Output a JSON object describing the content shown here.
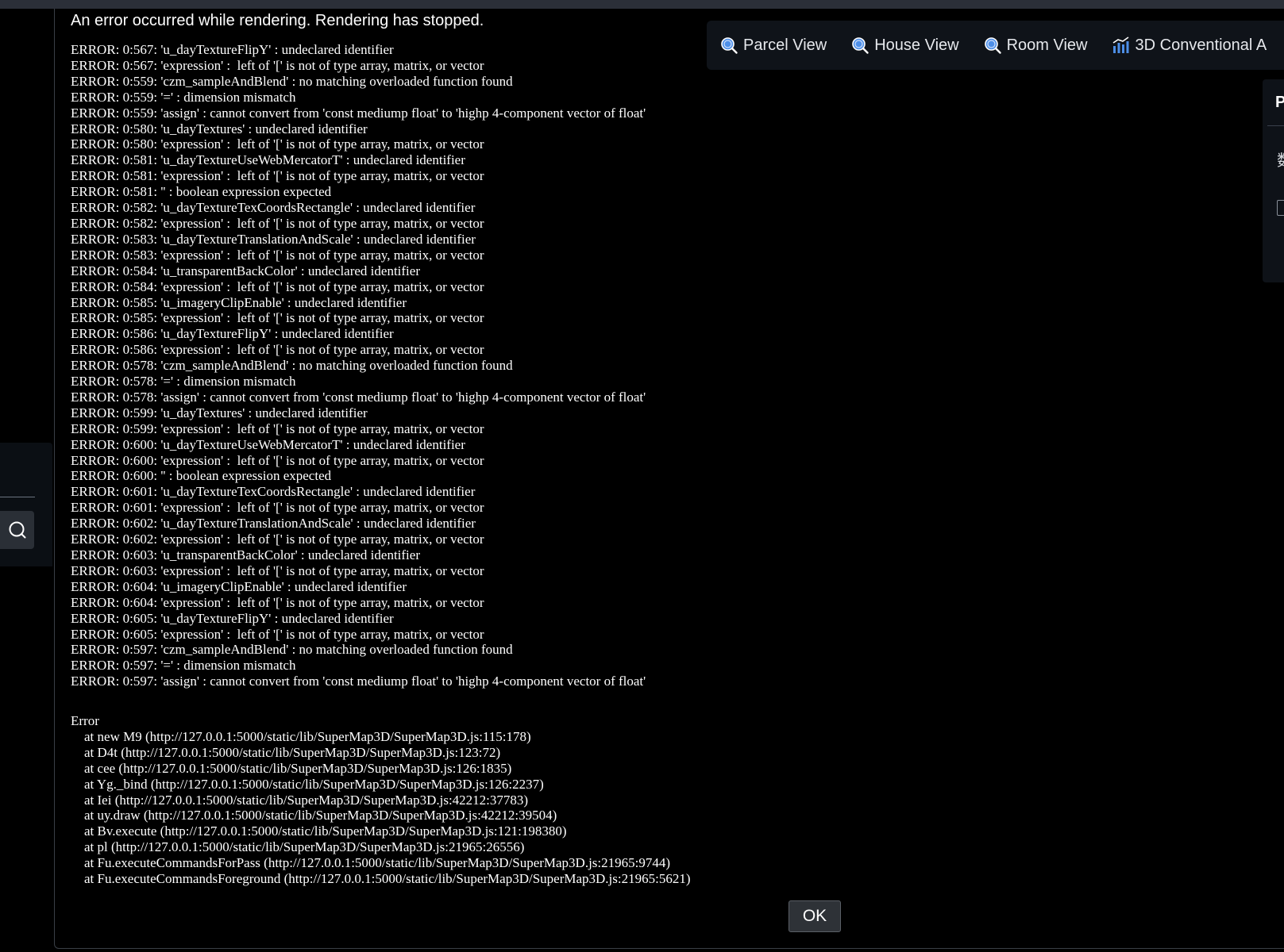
{
  "toolbar": {
    "items": [
      {
        "label": "Parcel View",
        "icon": "magnifier-icon"
      },
      {
        "label": "House View",
        "icon": "magnifier-icon"
      },
      {
        "label": "Room View",
        "icon": "magnifier-icon"
      },
      {
        "label": "3D Conventional A",
        "icon": "bar-chart-icon"
      }
    ],
    "accent_color": "#4d8fe8"
  },
  "right_panel": {
    "title": "P",
    "char": "数"
  },
  "dialog": {
    "title": "An error occurred while rendering. Rendering has stopped.",
    "log_lines": [
      "ERROR: 0:567: 'u_dayTextureFlipY' : undeclared identifier",
      "ERROR: 0:567: 'expression' :  left of '[' is not of type array, matrix, or vector",
      "ERROR: 0:559: 'czm_sampleAndBlend' : no matching overloaded function found",
      "ERROR: 0:559: '=' : dimension mismatch",
      "ERROR: 0:559: 'assign' : cannot convert from 'const mediump float' to 'highp 4-component vector of float'",
      "ERROR: 0:580: 'u_dayTextures' : undeclared identifier",
      "ERROR: 0:580: 'expression' :  left of '[' is not of type array, matrix, or vector",
      "ERROR: 0:581: 'u_dayTextureUseWebMercatorT' : undeclared identifier",
      "ERROR: 0:581: 'expression' :  left of '[' is not of type array, matrix, or vector",
      "ERROR: 0:581: '' : boolean expression expected",
      "ERROR: 0:582: 'u_dayTextureTexCoordsRectangle' : undeclared identifier",
      "ERROR: 0:582: 'expression' :  left of '[' is not of type array, matrix, or vector",
      "ERROR: 0:583: 'u_dayTextureTranslationAndScale' : undeclared identifier",
      "ERROR: 0:583: 'expression' :  left of '[' is not of type array, matrix, or vector",
      "ERROR: 0:584: 'u_transparentBackColor' : undeclared identifier",
      "ERROR: 0:584: 'expression' :  left of '[' is not of type array, matrix, or vector",
      "ERROR: 0:585: 'u_imageryClipEnable' : undeclared identifier",
      "ERROR: 0:585: 'expression' :  left of '[' is not of type array, matrix, or vector",
      "ERROR: 0:586: 'u_dayTextureFlipY' : undeclared identifier",
      "ERROR: 0:586: 'expression' :  left of '[' is not of type array, matrix, or vector",
      "ERROR: 0:578: 'czm_sampleAndBlend' : no matching overloaded function found",
      "ERROR: 0:578: '=' : dimension mismatch",
      "ERROR: 0:578: 'assign' : cannot convert from 'const mediump float' to 'highp 4-component vector of float'",
      "ERROR: 0:599: 'u_dayTextures' : undeclared identifier",
      "ERROR: 0:599: 'expression' :  left of '[' is not of type array, matrix, or vector",
      "ERROR: 0:600: 'u_dayTextureUseWebMercatorT' : undeclared identifier",
      "ERROR: 0:600: 'expression' :  left of '[' is not of type array, matrix, or vector",
      "ERROR: 0:600: '' : boolean expression expected",
      "ERROR: 0:601: 'u_dayTextureTexCoordsRectangle' : undeclared identifier",
      "ERROR: 0:601: 'expression' :  left of '[' is not of type array, matrix, or vector",
      "ERROR: 0:602: 'u_dayTextureTranslationAndScale' : undeclared identifier",
      "ERROR: 0:602: 'expression' :  left of '[' is not of type array, matrix, or vector",
      "ERROR: 0:603: 'u_transparentBackColor' : undeclared identifier",
      "ERROR: 0:603: 'expression' :  left of '[' is not of type array, matrix, or vector",
      "ERROR: 0:604: 'u_imageryClipEnable' : undeclared identifier",
      "ERROR: 0:604: 'expression' :  left of '[' is not of type array, matrix, or vector",
      "ERROR: 0:605: 'u_dayTextureFlipY' : undeclared identifier",
      "ERROR: 0:605: 'expression' :  left of '[' is not of type array, matrix, or vector",
      "ERROR: 0:597: 'czm_sampleAndBlend' : no matching overloaded function found",
      "ERROR: 0:597: '=' : dimension mismatch",
      "ERROR: 0:597: 'assign' : cannot convert from 'const mediump float' to 'highp 4-component vector of float'"
    ],
    "stack_lines": [
      "Error",
      "    at new M9 (http://127.0.0.1:5000/static/lib/SuperMap3D/SuperMap3D.js:115:178)",
      "    at D4t (http://127.0.0.1:5000/static/lib/SuperMap3D/SuperMap3D.js:123:72)",
      "    at cee (http://127.0.0.1:5000/static/lib/SuperMap3D/SuperMap3D.js:126:1835)",
      "    at Yg._bind (http://127.0.0.1:5000/static/lib/SuperMap3D/SuperMap3D.js:126:2237)",
      "    at Iei (http://127.0.0.1:5000/static/lib/SuperMap3D/SuperMap3D.js:42212:37783)",
      "    at uy.draw (http://127.0.0.1:5000/static/lib/SuperMap3D/SuperMap3D.js:42212:39504)",
      "    at Bv.execute (http://127.0.0.1:5000/static/lib/SuperMap3D/SuperMap3D.js:121:198380)",
      "    at pl (http://127.0.0.1:5000/static/lib/SuperMap3D/SuperMap3D.js:21965:26556)",
      "    at Fu.executeCommandsForPass (http://127.0.0.1:5000/static/lib/SuperMap3D/SuperMap3D.js:21965:9744)",
      "    at Fu.executeCommandsForeground (http://127.0.0.1:5000/static/lib/SuperMap3D/SuperMap3D.js:21965:5621)"
    ],
    "ok_label": "OK"
  }
}
